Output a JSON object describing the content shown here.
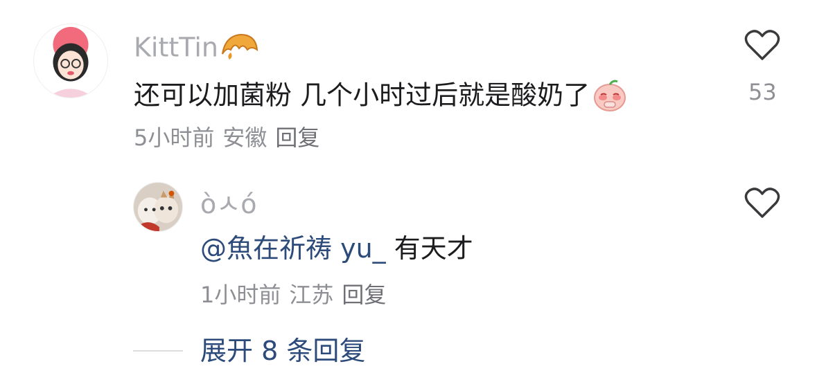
{
  "comments": [
    {
      "username": "KittTin",
      "username_emoji": "croissant-emoji",
      "text": "还可以加菌粉 几个小时过后就是酸奶了",
      "text_emoji": "pleading-face-emoji",
      "time": "5小时前",
      "location": "安徽",
      "reply_label": "回复",
      "likes": "53"
    }
  ],
  "replies": [
    {
      "username": "òㅅó",
      "mention": "@魚在祈祷 yu_",
      "text": " 有天才",
      "time": "1小时前",
      "location": "江苏",
      "reply_label": "回复"
    }
  ],
  "expand": {
    "label": "展开 8 条回复"
  },
  "colors": {
    "accent": "#2c4a7a",
    "meta": "#8e8f94",
    "username": "#a9aab0"
  }
}
